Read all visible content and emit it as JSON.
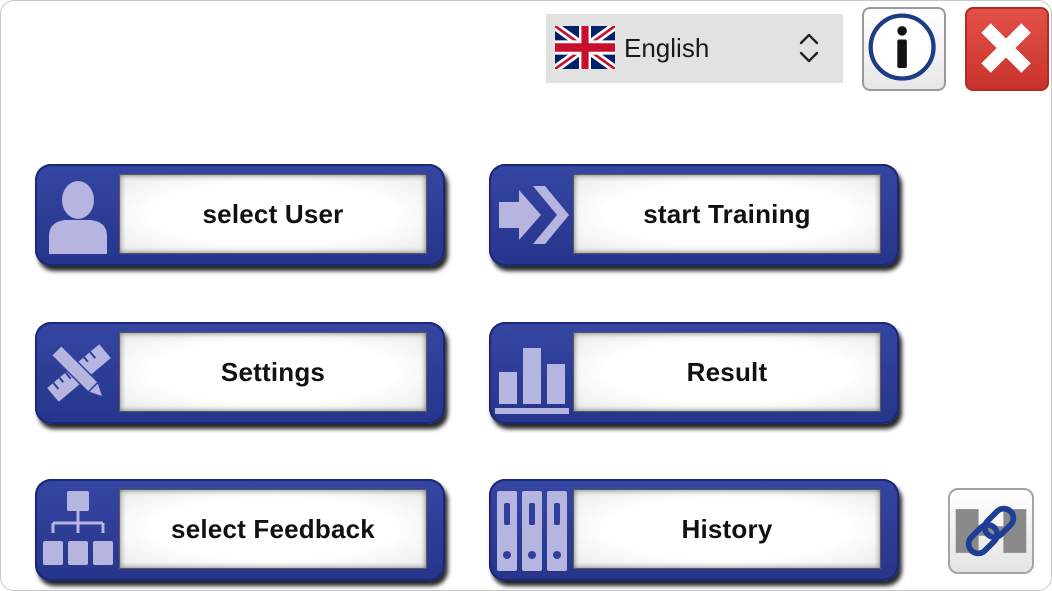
{
  "language_select": {
    "value": "English",
    "flag_icon": "uk-flag-icon",
    "chevron_icon": "chevron-up-down-icon"
  },
  "toolbar": {
    "info_icon": "info-icon",
    "close_icon": "close-icon",
    "link_icon": "link-icon"
  },
  "menu": {
    "select_user": "select User",
    "start_training": "start Training",
    "settings": "Settings",
    "result": "Result",
    "select_feedback": "select Feedback",
    "history": "History"
  },
  "colors": {
    "button_blue": "#2b3a95",
    "icon_lavender": "#b5b5e0",
    "close_red": "#d9423a",
    "info_blue": "#1d3c86"
  }
}
